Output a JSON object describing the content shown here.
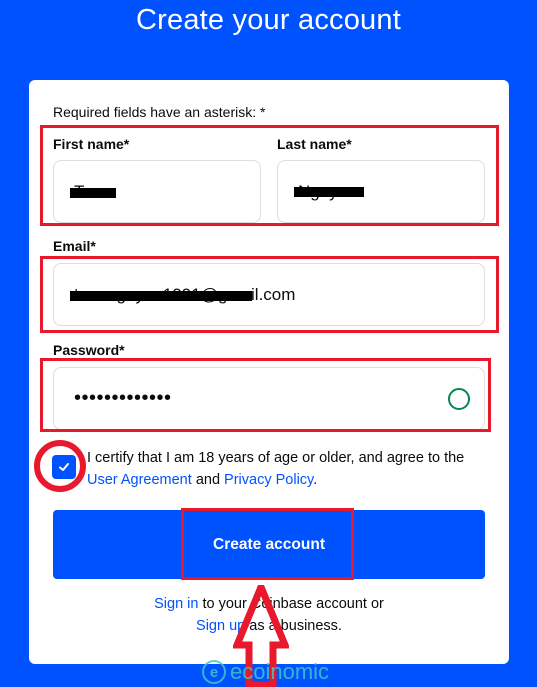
{
  "header": {
    "title": "Create your account"
  },
  "form": {
    "required_note": "Required fields have an asterisk: *",
    "first_name": {
      "label": "First name*",
      "value": "Toan",
      "redacted": true
    },
    "last_name": {
      "label": "Last name*",
      "value": "Nguyen",
      "redacted": true
    },
    "email": {
      "label": "Email*",
      "value_visible_part": "@gmail.com",
      "redacted_prefix": "toannguyen1991"
    },
    "password": {
      "label": "Password*",
      "masked_value": "•••••••••••••",
      "strength_indicator": "valid-circle-icon",
      "strength_color": "#098551"
    },
    "terms": {
      "checked": true,
      "text_before": "I certify that I am 18 years of age or older, and agree to the",
      "link_user_agreement": "User Agreement",
      "text_and": "and",
      "link_privacy_policy": "Privacy Policy",
      "text_end": "."
    },
    "submit_label": "Create account"
  },
  "footer": {
    "signin_link": "Sign in",
    "signin_text": "to your Coinbase account or",
    "signup_link": "Sign up",
    "signup_text": "as a business."
  },
  "annotations": {
    "highlight_color": "#e8192c"
  },
  "watermark": {
    "text": "ecoinomic",
    "icon": "e"
  },
  "colors": {
    "brand": "#0052ff",
    "background": "#0052ff",
    "card": "#ffffff"
  }
}
